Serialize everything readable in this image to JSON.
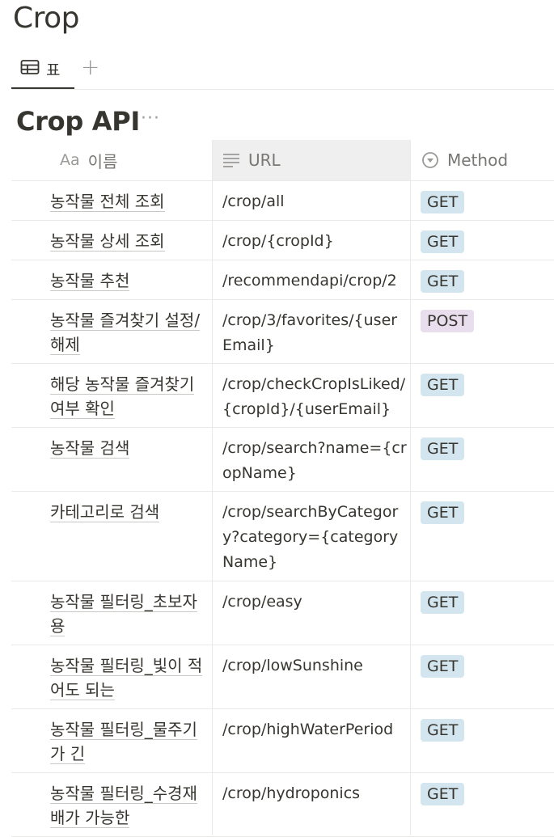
{
  "page": {
    "title": "Crop"
  },
  "tabs": [
    {
      "label": "표",
      "icon": "table-icon"
    }
  ],
  "tab_add_label": "+",
  "database": {
    "title": "Crop API",
    "more": "···"
  },
  "columns": {
    "name": {
      "icon_text": "Aa",
      "label": "이름"
    },
    "url": {
      "icon": "lines-icon",
      "label": "URL"
    },
    "method": {
      "icon": "select-icon",
      "label": "Method"
    }
  },
  "rows": [
    {
      "name": "농작물 전체 조회",
      "url": "/crop/all",
      "method": "GET"
    },
    {
      "name": "농작물 상세 조회",
      "url": "/crop/{cropId}",
      "method": "GET"
    },
    {
      "name": "농작물 추천",
      "url": "/recommendapi/crop/2",
      "method": "GET"
    },
    {
      "name": "농작물 즐겨찾기 설정/해제",
      "url": "/crop/3/favorites/{userEmail}",
      "method": "POST"
    },
    {
      "name": "해당 농작물 즐겨찾기 여부 확인",
      "url": "/crop/checkCropIsLiked/{cropId}/{userEmail}",
      "method": "GET"
    },
    {
      "name": "농작물 검색",
      "url": "/crop/search?name={cropName}",
      "method": "GET"
    },
    {
      "name": "카테고리로 검색",
      "url": "/crop/searchByCategory?category={categoryName}",
      "method": "GET"
    },
    {
      "name": "농작물 필터링_초보자용",
      "url": "/crop/easy",
      "method": "GET"
    },
    {
      "name": "농작물 필터링_빛이 적어도 되는",
      "url": "/crop/lowSunshine",
      "method": "GET"
    },
    {
      "name": "농작물 필터링_물주기가 긴",
      "url": "/crop/highWaterPeriod",
      "method": "GET"
    },
    {
      "name": "농작물 필터링_수경재배가 가능한",
      "url": "/crop/hydroponics",
      "method": "GET"
    }
  ],
  "colors": {
    "get_tag": "#d3e5ef",
    "post_tag": "#e8deee",
    "text": "#37352f",
    "muted": "#787774",
    "border": "#e9e9e7"
  }
}
